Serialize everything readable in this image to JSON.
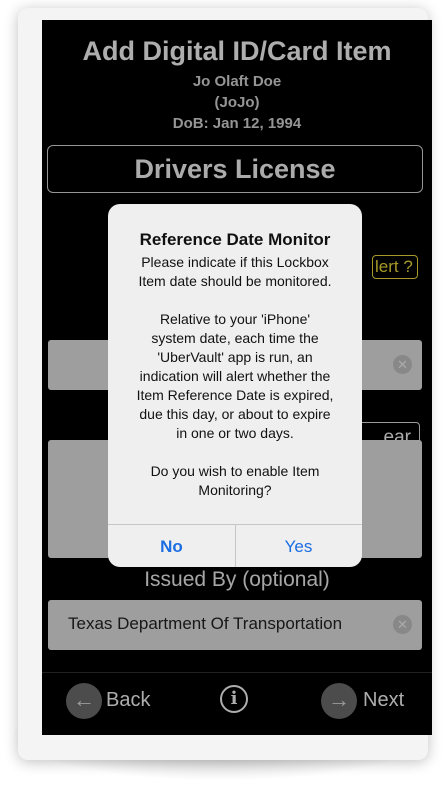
{
  "header": {
    "title": "Add Digital ID/Card Item",
    "name": "Jo Olaft Doe",
    "nickname": "(JoJo)",
    "dob": "DoB: Jan 12, 1994"
  },
  "document_type": "Drivers License",
  "alert_button_label": "lert ?",
  "clear_button_label": "ear",
  "field1": {
    "value": ""
  },
  "issued_by": {
    "label": "Issued By (optional)",
    "value": "Texas Department Of Transportation"
  },
  "toolbar": {
    "back_label": "Back",
    "next_label": "Next"
  },
  "dialog": {
    "title": "Reference Date Monitor",
    "message_lines_1": [
      "Please indicate if this Lockbox",
      "Item date should be monitored."
    ],
    "message_lines_2": [
      "Relative to your 'iPhone'",
      "system date, each time the",
      "'UberVault' app is run, an",
      "indication will alert whether the",
      "Item Reference Date is expired,",
      "due this day, or about to expire",
      "in one or two days."
    ],
    "message_lines_3": [
      "Do you wish to enable Item",
      "Monitoring?"
    ],
    "no_label": "No",
    "yes_label": "Yes"
  },
  "icons": {
    "back": "arrow-left-circle-icon",
    "next": "arrow-right-circle-icon",
    "info": "info-circle-icon",
    "clear": "clear-x-circle-icon"
  },
  "colors": {
    "alert_yellow": "#e6d43a",
    "ios_blue": "#1a6de3"
  }
}
